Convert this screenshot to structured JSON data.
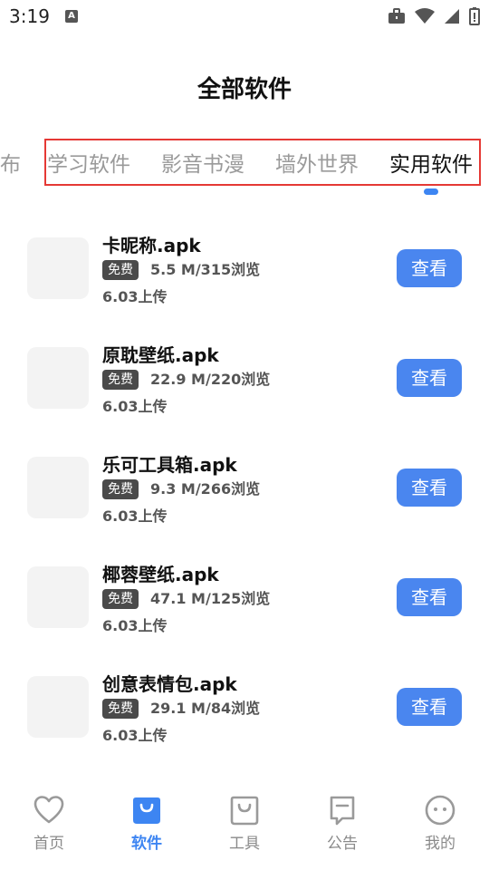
{
  "status": {
    "time": "3:19",
    "badge": "A"
  },
  "title": "全部软件",
  "tabs": [
    {
      "label": "布"
    },
    {
      "label": "学习软件"
    },
    {
      "label": "影音书漫"
    },
    {
      "label": "墙外世界"
    },
    {
      "label": "实用软件",
      "active": true
    }
  ],
  "items": [
    {
      "name": "卡昵称.apk",
      "badge": "免费",
      "meta": "5.5 M/315浏览",
      "date": "6.03上传",
      "button": "查看"
    },
    {
      "name": "原耽壁纸.apk",
      "badge": "免费",
      "meta": "22.9 M/220浏览",
      "date": "6.03上传",
      "button": "查看"
    },
    {
      "name": "乐可工具箱.apk",
      "badge": "免费",
      "meta": "9.3 M/266浏览",
      "date": "6.03上传",
      "button": "查看"
    },
    {
      "name": "椰蓉壁纸.apk",
      "badge": "免费",
      "meta": "47.1 M/125浏览",
      "date": "6.03上传",
      "button": "查看"
    },
    {
      "name": "创意表情包.apk",
      "badge": "免费",
      "meta": "29.1 M/84浏览",
      "date": "6.03上传",
      "button": "查看"
    }
  ],
  "nav": [
    {
      "label": "首页",
      "icon": "heart-icon"
    },
    {
      "label": "软件",
      "icon": "bag-icon",
      "active": true
    },
    {
      "label": "工具",
      "icon": "shopping-bag-icon"
    },
    {
      "label": "公告",
      "icon": "bookmark-icon"
    },
    {
      "label": "我的",
      "icon": "face-icon"
    }
  ],
  "colors": {
    "accent": "#3d85f2",
    "button": "#4a86ef",
    "highlight": "#e53935"
  }
}
